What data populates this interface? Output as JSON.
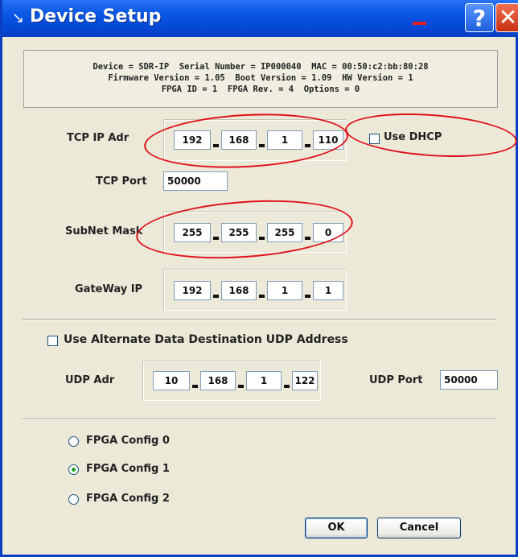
{
  "window": {
    "title": "Device Setup"
  },
  "info": {
    "line1": "Device = SDR-IP  Serial Number = IP000040  MAC = 00:50:c2:bb:80:28",
    "line2": "Firmware Version = 1.05  Boot Version = 1.09  HW Version = 1",
    "line3": "FPGA ID = 1  FPGA Rev. = 4  Options = 0"
  },
  "tcp_ip": {
    "label": "TCP IP Adr",
    "octets": [
      "192",
      "168",
      "1",
      "110"
    ]
  },
  "dhcp": {
    "label": "Use DHCP",
    "checked": false
  },
  "tcp_port": {
    "label": "TCP Port",
    "value": "50000"
  },
  "subnet": {
    "label": "SubNet Mask",
    "octets": [
      "255",
      "255",
      "255",
      "0"
    ]
  },
  "gateway": {
    "label": "GateWay IP",
    "octets": [
      "192",
      "168",
      "1",
      "1"
    ]
  },
  "alt_udp": {
    "label": "Use Alternate Data Destination UDP Address",
    "checked": false
  },
  "udp_adr": {
    "label": "UDP Adr",
    "octets": [
      "10",
      "168",
      "1",
      "122"
    ]
  },
  "udp_port": {
    "label": "UDP Port",
    "value": "50000"
  },
  "fpga": {
    "options": [
      "FPGA Config 0",
      "FPGA Config 1",
      "FPGA Config 2"
    ],
    "selected": "FPGA Config 1"
  },
  "buttons": {
    "ok": "OK",
    "cancel": "Cancel"
  },
  "colors": {
    "titlebar": "#0A58E4",
    "annotation": "#E0101A",
    "radio_dot": "#21A121"
  },
  "icons": {
    "title": "wrench-icon",
    "help": "help-icon",
    "close": "close-icon"
  }
}
